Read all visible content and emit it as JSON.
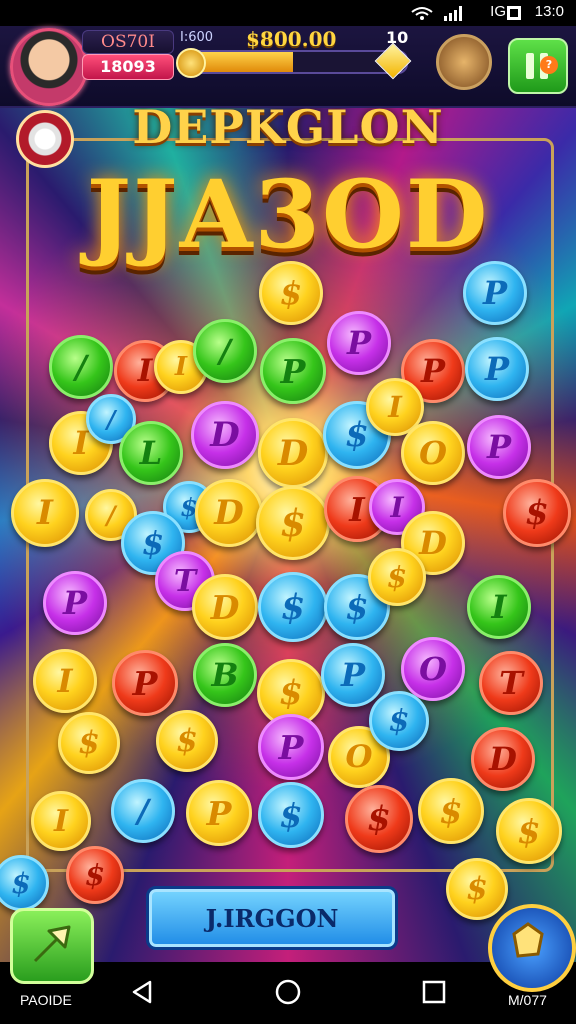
{
  "status_bar": {
    "time": "13:0",
    "carrier": "IG"
  },
  "hud": {
    "player_label": "OS70I",
    "player_coins": "18093",
    "mini_label": "I:600",
    "score": "$800.00",
    "level": "10",
    "progress": 0.5
  },
  "title": {
    "top": "DEPKGLON",
    "main": "JJA3OD"
  },
  "board": {
    "coins": [
      {
        "c": "y",
        "t": "$"
      },
      {
        "c": "b",
        "t": "P"
      },
      {
        "c": "g",
        "t": "/"
      },
      {
        "c": "r",
        "t": "I"
      },
      {
        "c": "y",
        "t": "I"
      },
      {
        "c": "g",
        "t": "/"
      },
      {
        "c": "g",
        "t": "P"
      },
      {
        "c": "p",
        "t": "P"
      },
      {
        "c": "r",
        "t": "P"
      },
      {
        "c": "b",
        "t": "P"
      },
      {
        "c": "y",
        "t": "I"
      },
      {
        "c": "b",
        "t": "/"
      },
      {
        "c": "g",
        "t": "L"
      },
      {
        "c": "p",
        "t": "D"
      },
      {
        "c": "y",
        "t": "D"
      },
      {
        "c": "b",
        "t": "$"
      },
      {
        "c": "y",
        "t": "I"
      },
      {
        "c": "y",
        "t": "O"
      },
      {
        "c": "p",
        "t": "P"
      },
      {
        "c": "y",
        "t": "I"
      },
      {
        "c": "y",
        "t": "/"
      },
      {
        "c": "b",
        "t": "$"
      },
      {
        "c": "y",
        "t": "D"
      },
      {
        "c": "y",
        "t": "$"
      },
      {
        "c": "r",
        "t": "I"
      },
      {
        "c": "p",
        "t": "I"
      },
      {
        "c": "y",
        "t": "D"
      },
      {
        "c": "r",
        "t": "$"
      },
      {
        "c": "p",
        "t": "P"
      },
      {
        "c": "b",
        "t": "$"
      },
      {
        "c": "p",
        "t": "T"
      },
      {
        "c": "y",
        "t": "D"
      },
      {
        "c": "b",
        "t": "$"
      },
      {
        "c": "b",
        "t": "$"
      },
      {
        "c": "y",
        "t": "$"
      },
      {
        "c": "g",
        "t": "I"
      },
      {
        "c": "y",
        "t": "I"
      },
      {
        "c": "r",
        "t": "P"
      },
      {
        "c": "g",
        "t": "B"
      },
      {
        "c": "y",
        "t": "$"
      },
      {
        "c": "b",
        "t": "P"
      },
      {
        "c": "p",
        "t": "O"
      },
      {
        "c": "r",
        "t": "T"
      },
      {
        "c": "y",
        "t": "$"
      },
      {
        "c": "y",
        "t": "$"
      },
      {
        "c": "p",
        "t": "P"
      },
      {
        "c": "y",
        "t": "O"
      },
      {
        "c": "b",
        "t": "$"
      },
      {
        "c": "r",
        "t": "D"
      },
      {
        "c": "b",
        "t": "/"
      },
      {
        "c": "y",
        "t": "P"
      },
      {
        "c": "b",
        "t": "$"
      },
      {
        "c": "r",
        "t": "$"
      },
      {
        "c": "y",
        "t": "$"
      },
      {
        "c": "y",
        "t": "$"
      },
      {
        "c": "y",
        "t": "I"
      },
      {
        "c": "r",
        "t": "$"
      },
      {
        "c": "y",
        "t": "$"
      },
      {
        "c": "b",
        "t": "$"
      }
    ]
  },
  "action_button": {
    "label": "J.IRGGON"
  },
  "nav": {
    "left_label": "PAOIDE",
    "right_label": "M/077"
  }
}
